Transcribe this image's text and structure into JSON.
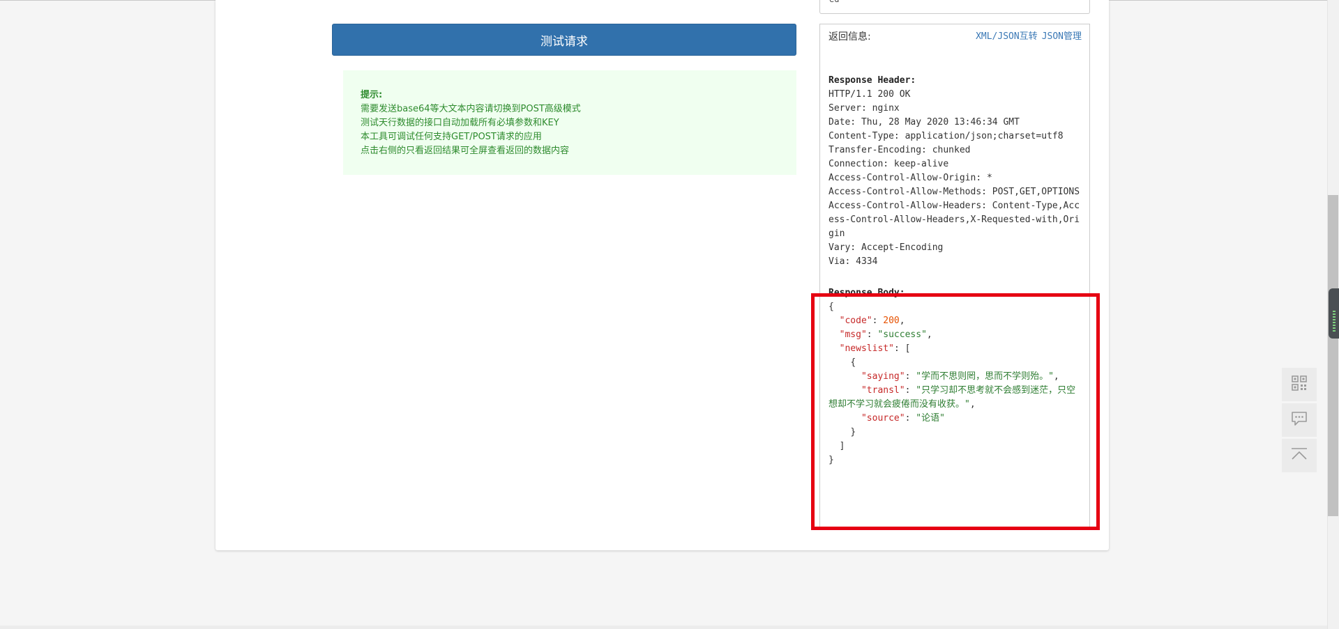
{
  "test_button": {
    "label": "测试请求"
  },
  "tips": {
    "title": "提示:",
    "lines": [
      "需要发送base64等大文本内容请切换到POST高级模式",
      "测试天行数据的接口自动加载所有必填参数和KEY",
      "本工具可调试任何支持GET/POST请求的应用",
      "点击右侧的只看返回结果可全屏查看返回的数据内容"
    ]
  },
  "prev_box": {
    "text": "ed"
  },
  "result": {
    "label": "返回信息:",
    "links": [
      "XML/JSON互转",
      "JSON管理"
    ],
    "header_title": "Response Header:",
    "header_lines": [
      "HTTP/1.1 200 OK",
      "Server: nginx",
      "Date: Thu, 28 May 2020 13:46:34 GMT",
      "Content-Type: application/json;charset=utf8",
      "Transfer-Encoding: chunked",
      "Connection: keep-alive",
      "Access-Control-Allow-Origin: *",
      "Access-Control-Allow-Methods: POST,GET,OPTIONS",
      "Access-Control-Allow-Headers: Content-Type,Access-Control-Allow-Headers,X-Requested-with,Origin",
      "Vary: Accept-Encoding",
      "Via: 4334"
    ],
    "body_title": "Response Body:",
    "body": {
      "open_brace": "{",
      "code_key": "\"code\"",
      "code_val": "200",
      "msg_key": "\"msg\"",
      "msg_val": "\"success\"",
      "newslist_key": "\"newslist\"",
      "arr_open": "[",
      "obj_open": "{",
      "saying_key": "\"saying\"",
      "saying_val": "\"学而不思则罔，思而不学则殆。\"",
      "transl_key": "\"transl\"",
      "transl_val": "\"只学习却不思考就不会感到迷茫，只空想却不学习就会疲倦而没有收获。\"",
      "source_key": "\"source\"",
      "source_val": "\"论语\"",
      "obj_close": "}",
      "arr_close": "]",
      "close_brace": "}"
    }
  },
  "float_tools": {
    "items": [
      {
        "icon": "qrcode-icon"
      },
      {
        "icon": "chat-icon"
      },
      {
        "icon": "back-to-top-icon"
      }
    ]
  },
  "colors": {
    "button_bg": "#3171ac",
    "tips_bg": "#f0fff0",
    "tips_text": "#2e8b2e",
    "highlight": "#e60012",
    "link": "#3a78b5"
  }
}
